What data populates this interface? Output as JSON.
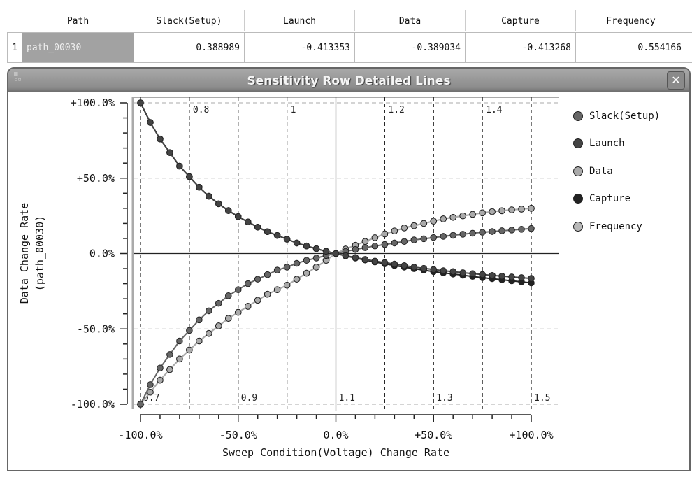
{
  "table": {
    "columns": [
      "",
      "Path",
      "Slack(Setup)",
      "Launch",
      "Data",
      "Capture",
      "Frequency"
    ],
    "rows": [
      {
        "index": "1",
        "path": "path_00030",
        "slack_setup": "0.388989",
        "launch": "-0.413353",
        "data": "-0.389034",
        "capture": "-0.413268",
        "frequency": "0.554166"
      }
    ]
  },
  "window": {
    "title": "Sensitivity Row Detailed Lines",
    "close_icon": "close-icon",
    "close_label": "✕"
  },
  "chart_data": {
    "type": "line",
    "title": "",
    "xlabel": "Sweep Condition(Voltage) Change Rate",
    "ylabel": "Data Change Rate",
    "ylabel2": "(path_00030)",
    "xlim": [
      -100,
      100
    ],
    "ylim": [
      -100,
      100
    ],
    "x_ticks": [
      -100,
      -50,
      0,
      50,
      100
    ],
    "x_tick_labels": [
      "-100.0%",
      "-50.0%",
      "0.0%",
      "+50.0%",
      "+100.0%"
    ],
    "y_ticks": [
      100,
      50,
      0,
      -50,
      -100
    ],
    "y_tick_labels": [
      "+100.0%",
      "+50.0%",
      "0.0%",
      "-50.0%",
      "-100.0%"
    ],
    "grid": true,
    "secondary_axis": {
      "name": "Voltage",
      "top_labels": [
        {
          "x": -75,
          "label": "0.8"
        },
        {
          "x": -25,
          "label": "1"
        },
        {
          "x": 25,
          "label": "1.2"
        },
        {
          "x": 75,
          "label": "1.4"
        }
      ],
      "bottom_labels": [
        {
          "x": -100,
          "label": "0.7"
        },
        {
          "x": -50,
          "label": "0.9"
        },
        {
          "x": 0,
          "label": "1.1"
        },
        {
          "x": 50,
          "label": "1.3"
        },
        {
          "x": 100,
          "label": "1.5"
        }
      ],
      "gridlines_x": [
        -100,
        -75,
        -50,
        -25,
        0,
        25,
        50,
        75,
        100
      ]
    },
    "legend_position": "right",
    "x": [
      -100,
      -95,
      -90,
      -85,
      -80,
      -75,
      -70,
      -65,
      -60,
      -55,
      -50,
      -45,
      -40,
      -35,
      -30,
      -25,
      -20,
      -15,
      -10,
      -5,
      0,
      5,
      10,
      15,
      20,
      25,
      30,
      35,
      40,
      45,
      50,
      55,
      60,
      65,
      70,
      75,
      80,
      85,
      90,
      95,
      100
    ],
    "series": [
      {
        "name": "Slack(Setup)",
        "color": "#666666",
        "values": [
          -100,
          -87,
          -76,
          -67,
          -58,
          -51,
          -44,
          -38,
          -33,
          -28,
          -24,
          -20,
          -17,
          -14,
          -11,
          -9,
          -6.5,
          -4.5,
          -3,
          -1.3,
          0,
          1.4,
          2.7,
          3.9,
          5,
          6,
          7,
          8,
          9,
          9.8,
          10.6,
          11.4,
          12.1,
          12.8,
          13.5,
          14.1,
          14.6,
          15.1,
          15.6,
          16.1,
          16.6
        ]
      },
      {
        "name": "Launch",
        "color": "#444444",
        "values": [
          100,
          87,
          76,
          67,
          58,
          51,
          44,
          38,
          33,
          28.5,
          24.5,
          21,
          17.5,
          14.5,
          12,
          9.5,
          7,
          5,
          3.2,
          1.5,
          0,
          -1.4,
          -2.7,
          -3.9,
          -5,
          -6,
          -7,
          -8,
          -9,
          -9.8,
          -10.6,
          -11.4,
          -12,
          -12.7,
          -13.3,
          -13.9,
          -14.5,
          -15,
          -15.5,
          -16,
          -16.5
        ]
      },
      {
        "name": "Data",
        "color": "#aaaaaa",
        "values": [
          -100,
          -92,
          -84,
          -77,
          -70,
          -64,
          -58,
          -53,
          -48,
          -43,
          -39,
          -35,
          -31,
          -27,
          -24,
          -21,
          -17,
          -13,
          -9,
          -4.5,
          0,
          3,
          5.5,
          8,
          10.5,
          13,
          15,
          17,
          18.5,
          20,
          21.5,
          23,
          24,
          25,
          26,
          27,
          27.8,
          28.4,
          29,
          29.5,
          30
        ]
      },
      {
        "name": "Capture",
        "color": "#222222",
        "values": [
          100,
          87,
          76,
          67,
          58,
          51,
          44,
          38,
          33,
          28.5,
          24.5,
          21,
          17.5,
          14.5,
          12,
          9.5,
          7,
          5,
          3.2,
          1.5,
          0,
          -1.6,
          -3,
          -4.3,
          -5.6,
          -6.8,
          -8,
          -9,
          -10,
          -11,
          -12,
          -12.8,
          -13.6,
          -14.4,
          -15.2,
          -16,
          -16.7,
          -17.4,
          -18.1,
          -18.8,
          -19.5
        ]
      },
      {
        "name": "Frequency",
        "color": "#b8b8b8",
        "values": [
          -100,
          -92,
          -84,
          -77,
          -70,
          -64,
          -58,
          -53,
          -48,
          -43,
          -39,
          -35,
          -31,
          -27,
          -24,
          -21,
          -17,
          -13,
          -9,
          -4.5,
          0,
          3,
          5.5,
          8,
          10.5,
          13,
          15,
          17,
          18.5,
          20,
          21.5,
          23,
          24,
          25,
          26,
          27,
          27.8,
          28.4,
          29,
          29.5,
          30
        ]
      }
    ]
  }
}
